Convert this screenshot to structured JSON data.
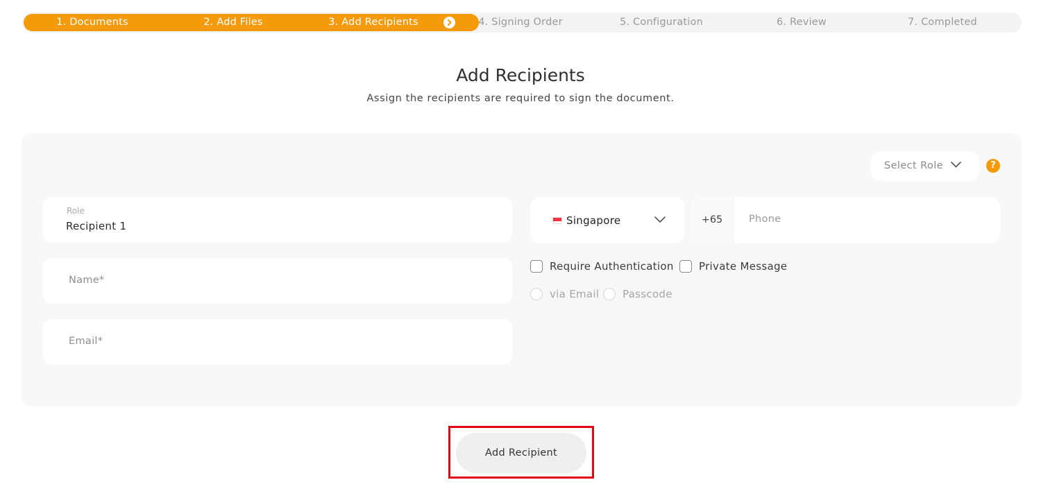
{
  "stepper": {
    "steps": [
      {
        "label": "1. Documents",
        "state": "done"
      },
      {
        "label": "2. Add Files",
        "state": "done"
      },
      {
        "label": "3. Add Recipients",
        "state": "current"
      },
      {
        "label": "4. Signing Order",
        "state": "pending"
      },
      {
        "label": "5. Configuration",
        "state": "pending"
      },
      {
        "label": "6. Review",
        "state": "pending"
      },
      {
        "label": "7. Completed",
        "state": "pending"
      }
    ],
    "accent_color": "#f59a0a",
    "current_icon": "chevron-right-circle-icon"
  },
  "header": {
    "title": "Add Recipients",
    "subtitle": "Assign the recipients are required to sign the document."
  },
  "recipient_form": {
    "role_select": {
      "placeholder": "Select Role",
      "icon": "chevron-down-icon"
    },
    "help_icon": {
      "glyph": "?",
      "icon": "help-icon"
    },
    "role_field": {
      "label": "Role",
      "value": "Recipient 1"
    },
    "name_field": {
      "placeholder": "Name*"
    },
    "email_field": {
      "placeholder": "Email*"
    },
    "country_select": {
      "value": "Singapore",
      "flag_icon": "singapore-flag-icon"
    },
    "phone": {
      "dial_code": "+65",
      "placeholder": "Phone"
    },
    "require_authentication": {
      "label": "Require Authentication",
      "checked": false
    },
    "private_message": {
      "label": "Private Message",
      "checked": false
    },
    "auth_methods": [
      {
        "label": "via Email",
        "selected": false,
        "disabled": true
      },
      {
        "label": "Passcode",
        "selected": false,
        "disabled": true
      }
    ]
  },
  "actions": {
    "add_recipient_label": "Add Recipient"
  }
}
